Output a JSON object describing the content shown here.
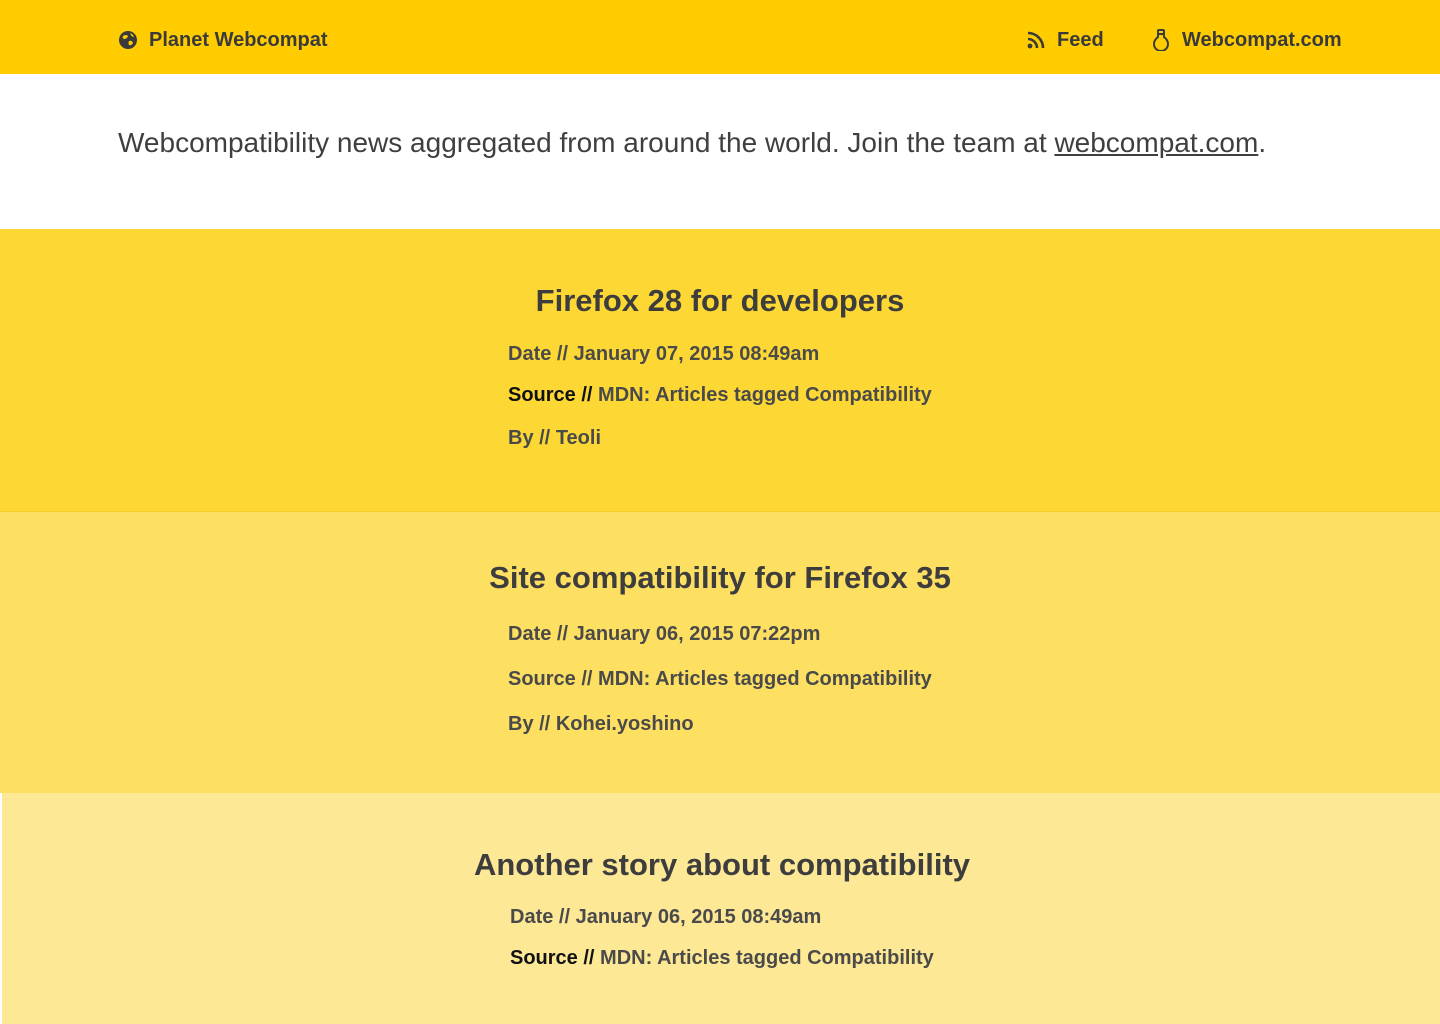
{
  "header": {
    "brand_label": "Planet Webcompat",
    "brand_icon": "globe-icon",
    "nav": [
      {
        "label": "Feed",
        "icon": "rss-feed-icon"
      },
      {
        "label": "Webcompat.com",
        "icon": "lightbulb-icon"
      }
    ],
    "background_color": "#ffcc00"
  },
  "intro": {
    "text": "Webcompatibility news aggregated from around the world. Join the team at ",
    "link_text": "webcompat.com",
    "suffix": "."
  },
  "labels": {
    "date": "Date //",
    "source": "Source //",
    "by": "By //"
  },
  "articles": [
    {
      "title": "Firefox 28 for developers",
      "date": "January 07, 2015 08:49am",
      "source": "MDN: Articles tagged Compatibility",
      "author": "Teoli",
      "background_color": "#fdd835"
    },
    {
      "title": "Site compatibility for Firefox 35",
      "date": "January 06, 2015 07:22pm",
      "source": "MDN: Articles tagged Compatibility",
      "author": "Kohei.yoshino",
      "background_color": "#fddf62"
    },
    {
      "title": "Another story about compatibility",
      "date": "January 06, 2015 08:49am",
      "source": "MDN: Articles tagged Compatibility",
      "background_color": "#fde896"
    }
  ]
}
